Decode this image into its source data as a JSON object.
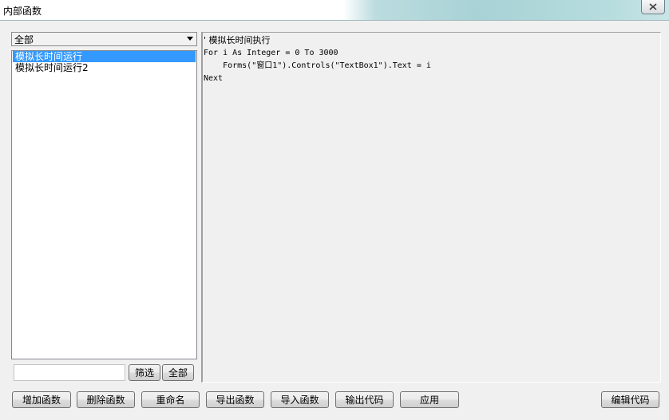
{
  "window": {
    "title": "内部函数"
  },
  "category": {
    "selected": "全部"
  },
  "functions": {
    "items": [
      {
        "label": "模拟长时间运行"
      },
      {
        "label": "模拟长时间运行2"
      }
    ],
    "selected_index": 0
  },
  "filter": {
    "value": "",
    "filter_label": "筛选",
    "all_label": "全部"
  },
  "code": {
    "lines": [
      "' 模拟长时间执行",
      "For i As Integer = 0 To 3000",
      "    Forms(\"窗口1\").Controls(\"TextBox1\").Text = i",
      "Next"
    ]
  },
  "buttons": {
    "add": "增加函数",
    "delete": "删除函数",
    "rename": "重命名",
    "export": "导出函数",
    "import": "导入函数",
    "output_code": "输出代码",
    "apply": "应用",
    "edit_code": "编辑代码"
  },
  "icons": {
    "close": "close-icon",
    "dropdown": "chevron-down-icon"
  }
}
